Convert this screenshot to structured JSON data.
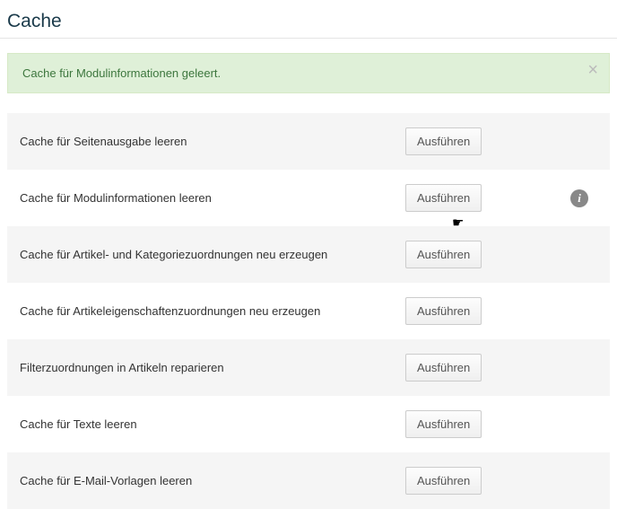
{
  "page": {
    "title": "Cache"
  },
  "alert": {
    "message": "Cache für Modulinformationen geleert.",
    "close_glyph": "×"
  },
  "buttons": {
    "execute": "Ausführen"
  },
  "info_icon_glyph": "i",
  "rows": [
    {
      "label": "Cache für Seitenausgabe leeren",
      "info": false
    },
    {
      "label": "Cache für Modulinformationen leeren",
      "info": true
    },
    {
      "label": "Cache für Artikel- und Kategoriezuordnungen neu erzeugen",
      "info": false
    },
    {
      "label": "Cache für Artikeleigenschaftenzuordnungen neu erzeugen",
      "info": false
    },
    {
      "label": "Filterzuordnungen in Artikeln reparieren",
      "info": false
    },
    {
      "label": "Cache für Texte leeren",
      "info": false
    },
    {
      "label": "Cache für E-Mail-Vorlagen leeren",
      "info": false
    }
  ]
}
